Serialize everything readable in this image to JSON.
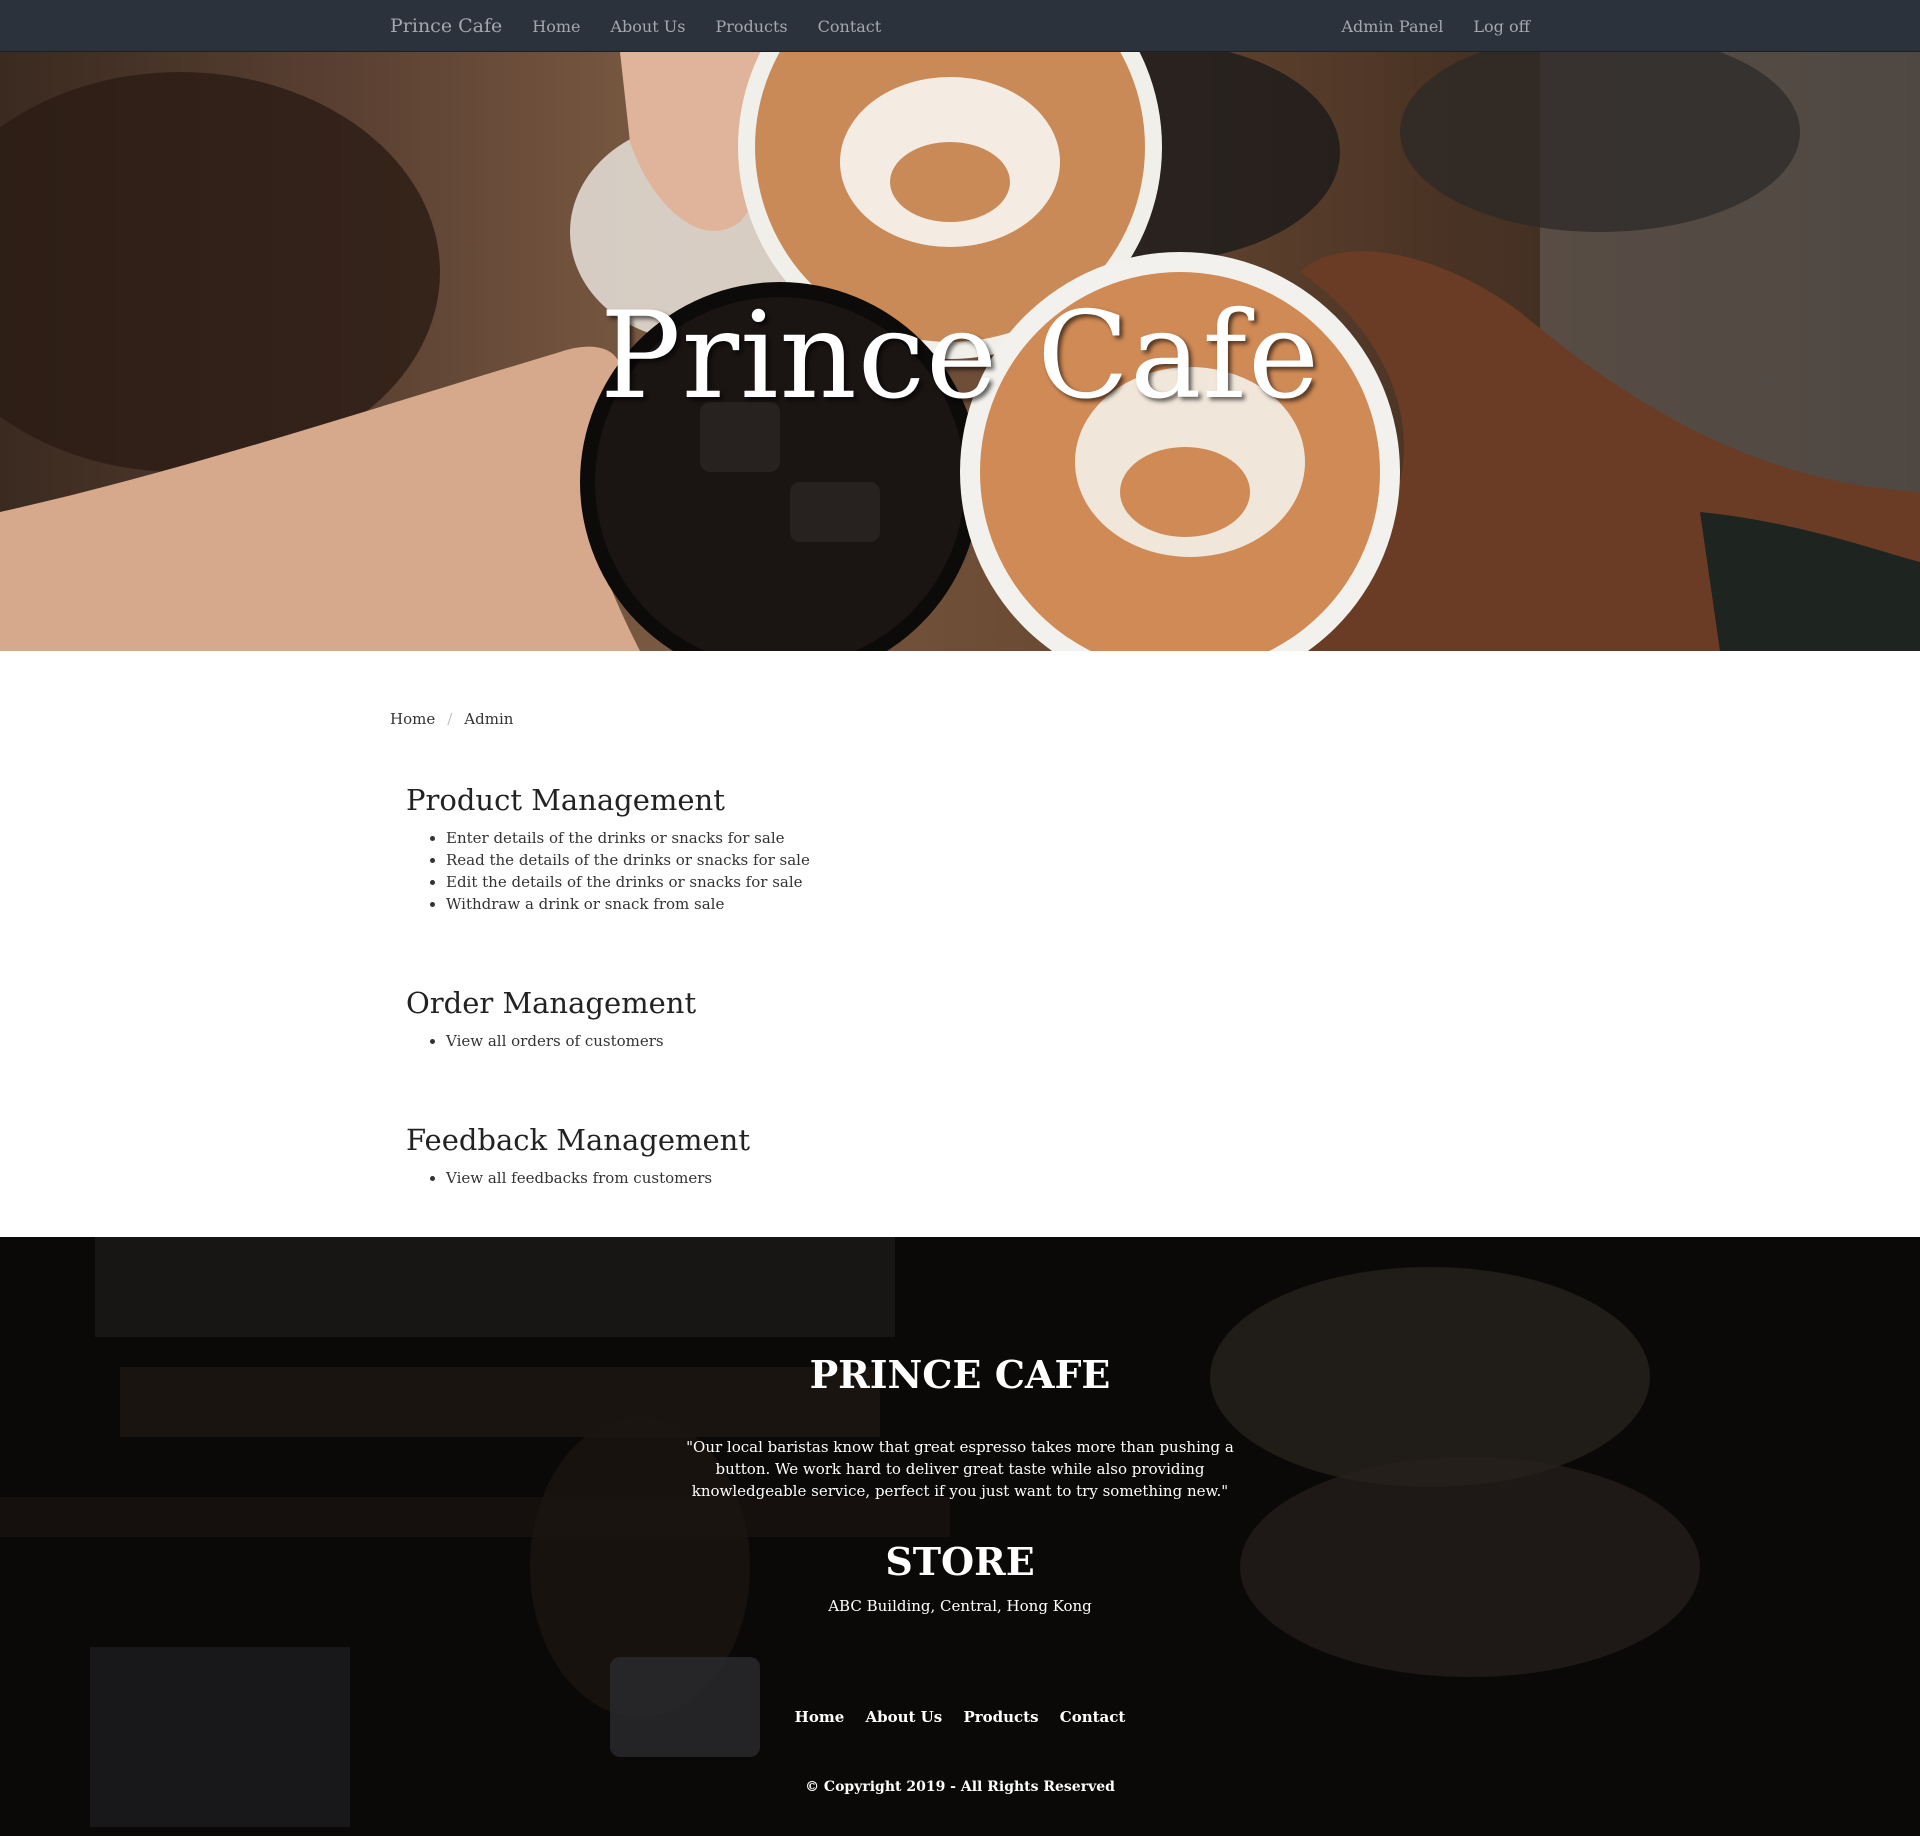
{
  "nav": {
    "brand": "Prince Cafe",
    "links": [
      "Home",
      "About Us",
      "Products",
      "Contact"
    ],
    "right_links": [
      "Admin Panel",
      "Log off"
    ]
  },
  "hero": {
    "title": "Prince Cafe"
  },
  "breadcrumb": {
    "items": [
      "Home",
      "Admin"
    ],
    "separator": "/"
  },
  "sections": [
    {
      "heading": "Product Management",
      "items": [
        "Enter details of the drinks or snacks for sale",
        "Read the details of the drinks or snacks for sale",
        "Edit the details of the drinks or snacks for sale",
        "Withdraw a drink or snack from sale"
      ]
    },
    {
      "heading": "Order Management",
      "items": [
        "View all orders of customers"
      ]
    },
    {
      "heading": "Feedback Management",
      "items": [
        "View all feedbacks from customers"
      ]
    }
  ],
  "footer": {
    "title": "PRINCE CAFE",
    "quote": "\"Our local baristas know that great espresso takes more than pushing a button. We work hard to deliver great taste while also providing knowledgeable service, perfect if you just want to try something new.\"",
    "store_heading": "STORE",
    "address": "ABC Building, Central, Hong Kong",
    "links": [
      "Home",
      "About Us",
      "Products",
      "Contact"
    ],
    "copyright": "© Copyright 2019 - All Rights Reserved"
  },
  "colors": {
    "navbar_bg": "#2c323c",
    "nav_text": "#a3a8ae",
    "footer_bg": "#0b0908"
  }
}
